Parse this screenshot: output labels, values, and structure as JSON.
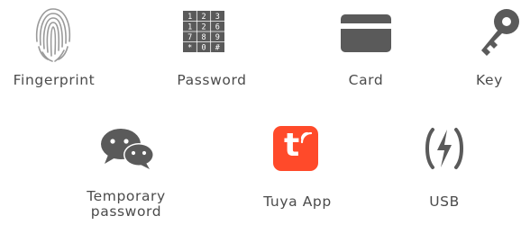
{
  "methods": [
    {
      "label": "Fingerprint",
      "icon": "fingerprint-icon"
    },
    {
      "label": "Password",
      "icon": "keypad-icon",
      "keys": [
        "1",
        "2",
        "3",
        "1",
        "2",
        "6",
        "7",
        "8",
        "9",
        "*",
        "0",
        "#"
      ]
    },
    {
      "label": "Card",
      "icon": "card-icon"
    },
    {
      "label": "Key",
      "icon": "key-icon"
    },
    {
      "label_line1": "Temporary",
      "label_line2": "password",
      "icon": "chat-icon"
    },
    {
      "label": "Tuya App",
      "icon": "tuya-app-icon",
      "app_letter": "t"
    },
    {
      "label": "USB",
      "icon": "usb-power-icon"
    }
  ],
  "colors": {
    "icon_gray": "#5a5a5a",
    "tuya_red": "#ff4a2a",
    "text": "#4b4b4b"
  }
}
